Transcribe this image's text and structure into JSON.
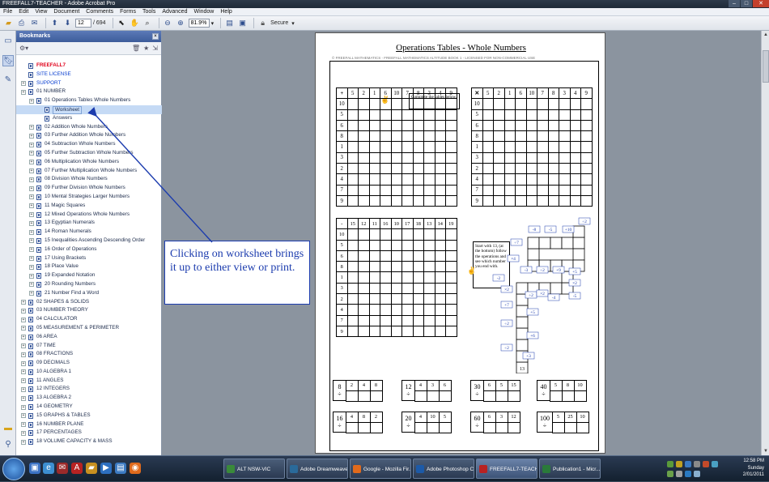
{
  "window": {
    "title": "FREEFALL7-TEACHER - Adobe Acrobat Pro"
  },
  "menu": [
    "File",
    "Edit",
    "View",
    "Document",
    "Comments",
    "Forms",
    "Tools",
    "Advanced",
    "Window",
    "Help"
  ],
  "toolbar": {
    "page_number": "12",
    "page_total": "/ 694",
    "zoom": "81.9%",
    "secure_label": "Secure"
  },
  "bookmarks_panel": {
    "title": "Bookmarks"
  },
  "tree": [
    {
      "label": "FREEFALL7",
      "style": "red",
      "level": 0,
      "exp": false
    },
    {
      "label": "SITE LICENSE",
      "style": "blue",
      "level": 0,
      "exp": false
    },
    {
      "label": "SUPPORT",
      "style": "blue",
      "level": 0,
      "exp": true
    },
    {
      "label": "01 NUMBER",
      "style": "",
      "level": 0,
      "exp": true
    },
    {
      "label": "01 Operations Tables Whole Numbers",
      "style": "",
      "level": 1,
      "exp": true
    },
    {
      "label": "Worksheet",
      "style": "sel",
      "level": 2,
      "exp": false
    },
    {
      "label": "Answers",
      "style": "",
      "level": 2,
      "exp": false
    },
    {
      "label": "02 Addition Whole Numbers",
      "style": "",
      "level": 1,
      "exp": true
    },
    {
      "label": "03 Further Addition Whole Numbers",
      "style": "",
      "level": 1,
      "exp": true
    },
    {
      "label": "04 Subtraction Whole Numbers",
      "style": "",
      "level": 1,
      "exp": true
    },
    {
      "label": "05 Further Subtraction Whole Numbers",
      "style": "",
      "level": 1,
      "exp": true
    },
    {
      "label": "06 Multiplication Whole Numbers",
      "style": "",
      "level": 1,
      "exp": true
    },
    {
      "label": "07 Further Multiplication Whole Numbers",
      "style": "",
      "level": 1,
      "exp": true
    },
    {
      "label": "08 Division Whole Numbers",
      "style": "",
      "level": 1,
      "exp": true
    },
    {
      "label": "09 Further Division Whole Numbers",
      "style": "",
      "level": 1,
      "exp": true
    },
    {
      "label": "10 Mental Strategies Larger Numbers",
      "style": "",
      "level": 1,
      "exp": true
    },
    {
      "label": "11 Magic Squares",
      "style": "",
      "level": 1,
      "exp": true
    },
    {
      "label": "12 Mixed Operations Whole Numbers",
      "style": "",
      "level": 1,
      "exp": true
    },
    {
      "label": "13 Egyptian Numerals",
      "style": "",
      "level": 1,
      "exp": true
    },
    {
      "label": "14 Roman Numerals",
      "style": "",
      "level": 1,
      "exp": true
    },
    {
      "label": "15 Inequalities Ascending Descending Order",
      "style": "",
      "level": 1,
      "exp": true
    },
    {
      "label": "16 Order of Operations",
      "style": "",
      "level": 1,
      "exp": true
    },
    {
      "label": "17 Using Brackets",
      "style": "",
      "level": 1,
      "exp": true
    },
    {
      "label": "18 Place Value",
      "style": "",
      "level": 1,
      "exp": true
    },
    {
      "label": "19 Expanded Notation",
      "style": "",
      "level": 1,
      "exp": true
    },
    {
      "label": "20 Rounding Numbers",
      "style": "",
      "level": 1,
      "exp": true
    },
    {
      "label": "21 Number Find a Word",
      "style": "",
      "level": 1,
      "exp": true
    },
    {
      "label": "02 SHAPES & SOLIDS",
      "style": "",
      "level": 0,
      "exp": true
    },
    {
      "label": "03 NUMBER THEORY",
      "style": "",
      "level": 0,
      "exp": true
    },
    {
      "label": "04 CALCULATOR",
      "style": "",
      "level": 0,
      "exp": true
    },
    {
      "label": "05 MEASUREMENT & PERIMETER",
      "style": "",
      "level": 0,
      "exp": true
    },
    {
      "label": "06 AREA",
      "style": "",
      "level": 0,
      "exp": true
    },
    {
      "label": "07 TIME",
      "style": "",
      "level": 0,
      "exp": true
    },
    {
      "label": "08 FRACTIONS",
      "style": "",
      "level": 0,
      "exp": true
    },
    {
      "label": "09 DECIMALS",
      "style": "",
      "level": 0,
      "exp": true
    },
    {
      "label": "10 ALGEBRA 1",
      "style": "",
      "level": 0,
      "exp": true
    },
    {
      "label": "11 ANGLES",
      "style": "",
      "level": 0,
      "exp": true
    },
    {
      "label": "12 INTEGERS",
      "style": "",
      "level": 0,
      "exp": true
    },
    {
      "label": "13 ALGEBRA 2",
      "style": "",
      "level": 0,
      "exp": true
    },
    {
      "label": "14 GEOMETRY",
      "style": "",
      "level": 0,
      "exp": true
    },
    {
      "label": "15 GRAPHS & TABLES",
      "style": "",
      "level": 0,
      "exp": true
    },
    {
      "label": "16 NUMBER PLANE",
      "style": "",
      "level": 0,
      "exp": true
    },
    {
      "label": "17 PERCENTAGES",
      "style": "",
      "level": 0,
      "exp": true
    },
    {
      "label": "18 VOLUME CAPACITY & MASS",
      "style": "",
      "level": 0,
      "exp": true
    }
  ],
  "document": {
    "title": "Operations Tables - Whole Numbers",
    "copyright": "© FREEFALL MATHEMATICS - FREEFALL MATHEMATICS ALTITUDE BOOK 1 - LICENSED FOR NON-COMMERCIAL USE",
    "note_complete": "Complete the tables below.",
    "note_start": "Start with 13, (at the bottom) follow the operations and see which number you end with.",
    "table_add": {
      "op": "+",
      "cols": [
        "5",
        "2",
        "1",
        "6",
        "10",
        "7",
        "8",
        "3",
        "4",
        "9"
      ],
      "rows": [
        "10",
        "5",
        "6",
        "8",
        "1",
        "3",
        "2",
        "4",
        "7",
        "9"
      ]
    },
    "table_mul": {
      "op": "✕",
      "cols": [
        "5",
        "2",
        "1",
        "6",
        "10",
        "7",
        "8",
        "3",
        "4",
        "9"
      ],
      "rows": [
        "10",
        "5",
        "6",
        "8",
        "1",
        "3",
        "2",
        "4",
        "7",
        "9"
      ]
    },
    "table_sub": {
      "op": "-",
      "cols": [
        "15",
        "12",
        "11",
        "16",
        "10",
        "17",
        "18",
        "13",
        "14",
        "19"
      ],
      "rows": [
        "10",
        "5",
        "6",
        "8",
        "1",
        "3",
        "2",
        "4",
        "7",
        "9"
      ]
    },
    "maze": {
      "start": "13",
      "ops": [
        "+3",
        "÷2",
        "+6",
        "÷2",
        "+5",
        "+7",
        "×2",
        "-2",
        "÷2",
        "×2",
        "-4",
        "-5",
        "×2",
        "+5",
        "+9",
        "÷2",
        "-3",
        "×4",
        "÷7",
        "-8",
        "-5",
        "+10",
        "÷2"
      ]
    },
    "puzzles": [
      {
        "top": "8",
        "bottom": "÷",
        "vals": [
          "2",
          "4",
          "8"
        ]
      },
      {
        "top": "12",
        "bottom": "÷",
        "vals": [
          "4",
          "3",
          "6"
        ]
      },
      {
        "top": "30",
        "bottom": "÷",
        "vals": [
          "6",
          "5",
          "15"
        ]
      },
      {
        "top": "40",
        "bottom": "÷",
        "vals": [
          "5",
          "8",
          "10"
        ]
      },
      {
        "top": "16",
        "bottom": "÷",
        "vals": [
          "4",
          "8",
          "2"
        ]
      },
      {
        "top": "20",
        "bottom": "÷",
        "vals": [
          "4",
          "10",
          "5"
        ]
      },
      {
        "top": "60",
        "bottom": "÷",
        "vals": [
          "6",
          "3",
          "12"
        ]
      },
      {
        "top": "100",
        "bottom": "÷",
        "vals": [
          "5",
          "25",
          "10"
        ]
      }
    ]
  },
  "callout": {
    "text": "Clicking on worksheet brings it up to either view or print."
  },
  "taskbar": {
    "buttons": [
      "ALT NSW-VIC",
      "Adobe Dreamweave...",
      "Google - Mozilla Fir...",
      "Adobe Photoshop C...",
      "FREEFALL7-TEACHE...",
      "Publication1 - Micr..."
    ],
    "time": "12:58 PM",
    "day": "Sunday",
    "date": "2/01/2011"
  },
  "colors": {
    "accent": "#1c3cae",
    "red_bookmark": "#e0001a",
    "blue_bookmark": "#0a3fd0"
  }
}
